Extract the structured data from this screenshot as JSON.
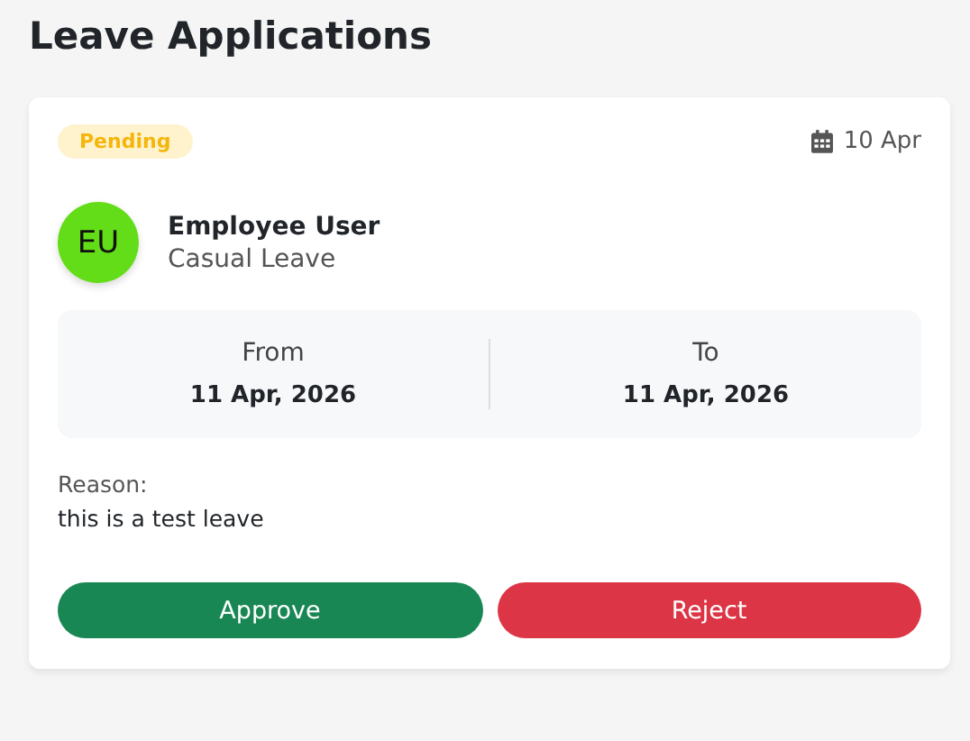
{
  "page": {
    "title": "Leave Applications"
  },
  "applications": [
    {
      "status": {
        "label": "Pending",
        "kind": "pending"
      },
      "date": "10 Apr",
      "avatar": {
        "initials": "EU"
      },
      "employee": "Employee User",
      "leave_type": "Casual Leave",
      "period": [
        {
          "label": "From",
          "value": "11 Apr, 2026"
        },
        {
          "label": "To",
          "value": "11 Apr, 2026"
        }
      ],
      "reason_label": "Reason:",
      "reason": "this is a test leave",
      "actions": [
        {
          "label": "Approve",
          "kind": "approve"
        },
        {
          "label": "Reject",
          "kind": "reject"
        }
      ]
    }
  ]
}
